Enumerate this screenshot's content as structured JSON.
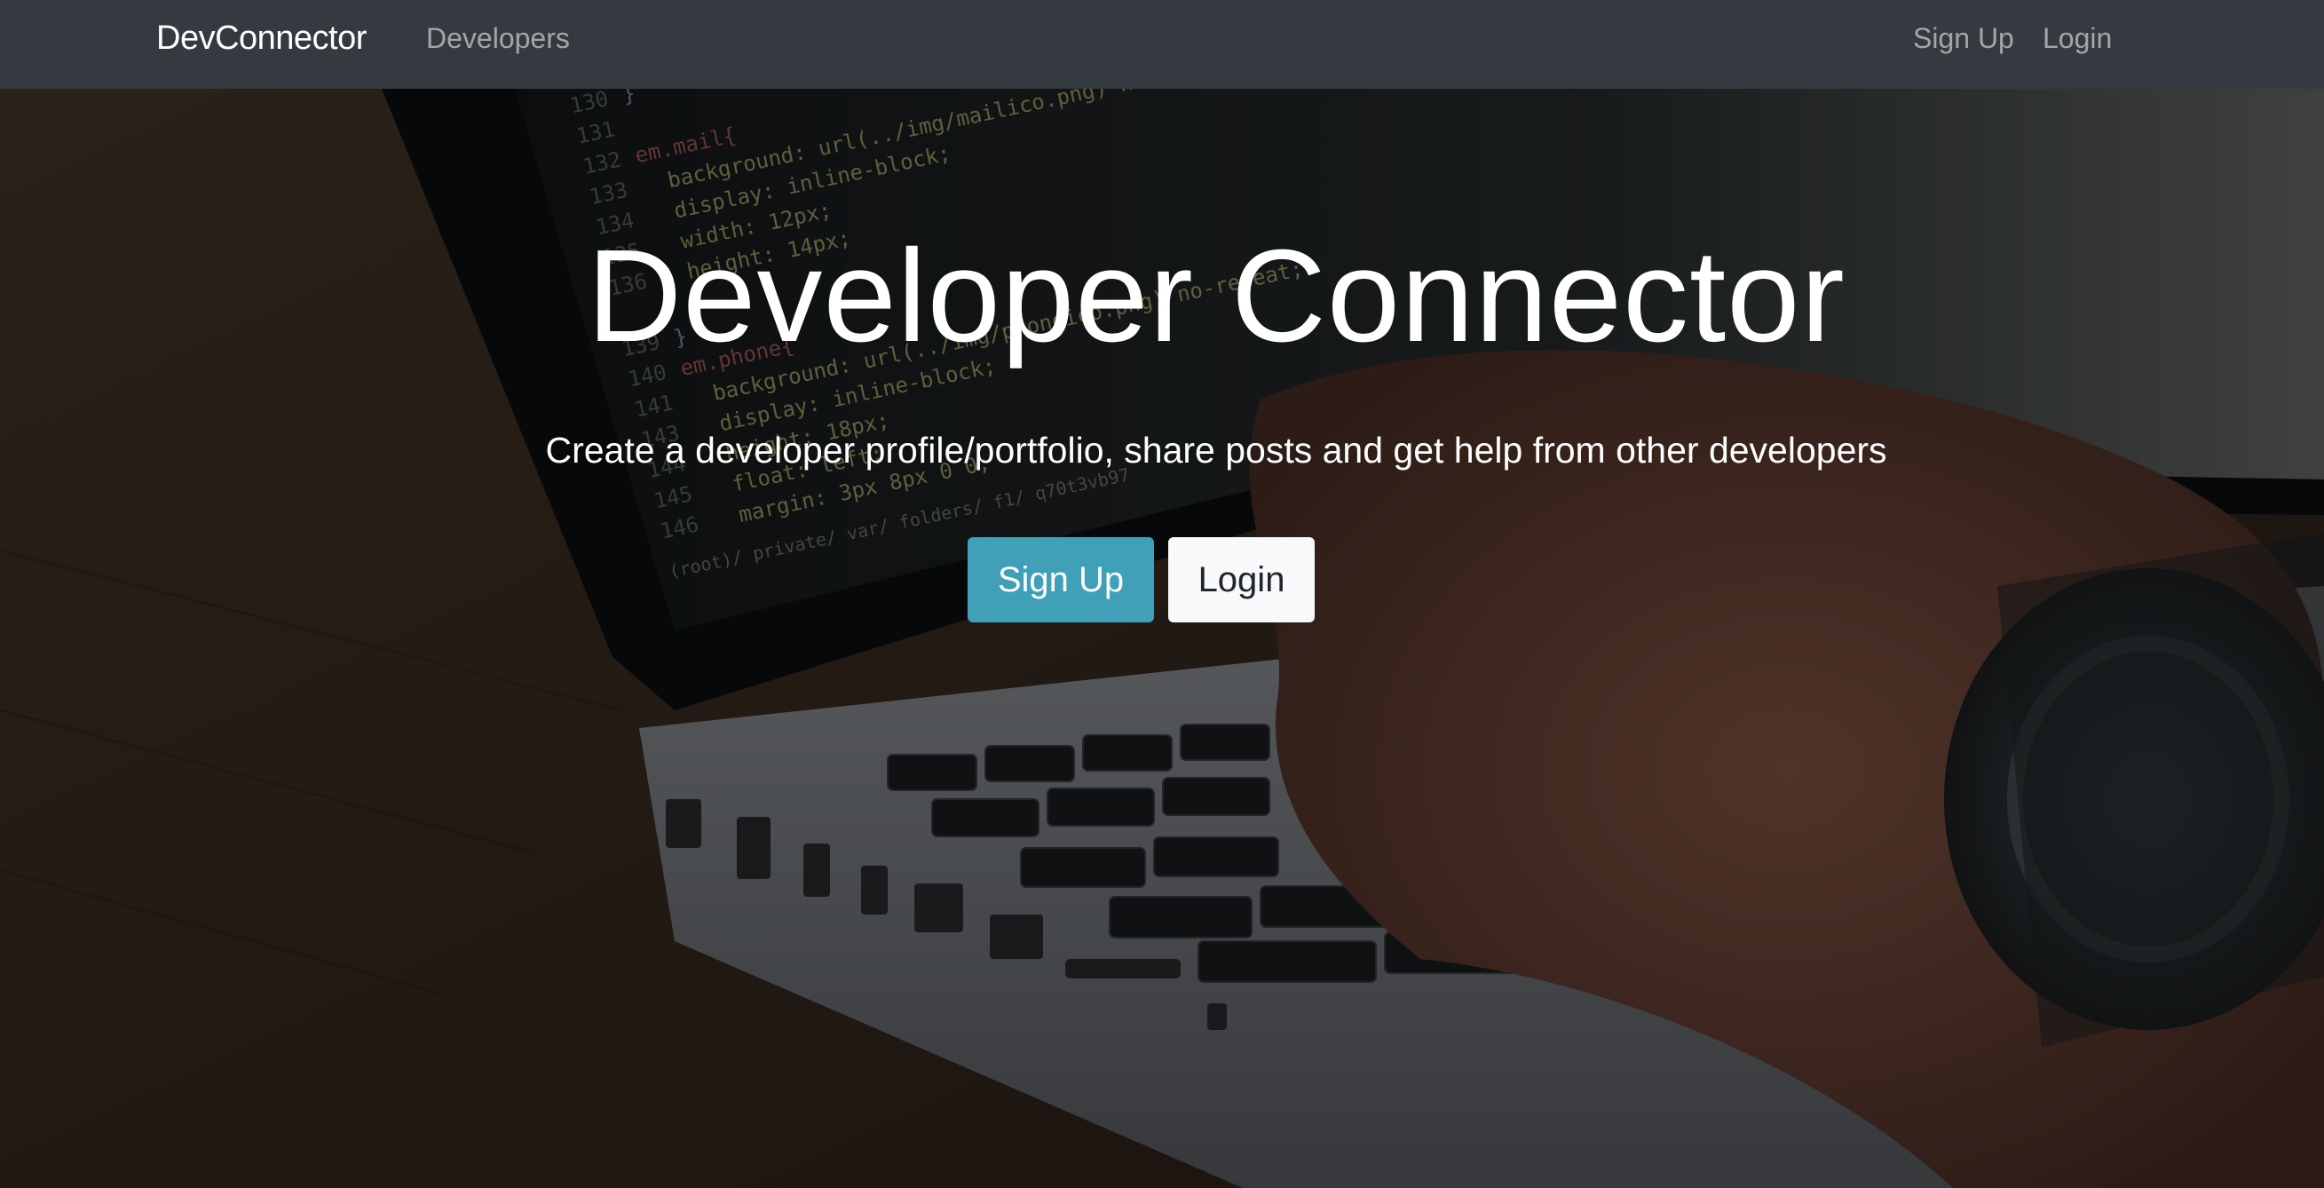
{
  "navbar": {
    "brand": "DevConnector",
    "links": {
      "developers": "Developers",
      "sign_up": "Sign Up",
      "login": "Login"
    },
    "background": "#343a40"
  },
  "hero": {
    "title": "Developer Connector",
    "lead": "Create a developer profile/portfolio, share posts and get help from other developers",
    "buttons": {
      "sign_up": "Sign Up",
      "login": "Login"
    },
    "background_image": "laptop-keyboard-photo",
    "code_lines": [
      {
        "num": "130",
        "text": "}"
      },
      {
        "num": "131",
        "text": ""
      },
      {
        "num": "132",
        "text": "em.mail{"
      },
      {
        "num": "133",
        "text": "  background: url(../img/mailico.png) no-repeat center;"
      },
      {
        "num": "134",
        "text": "  display: inline-block;"
      },
      {
        "num": "135",
        "text": "  width: 12px;"
      },
      {
        "num": "136",
        "text": "  height: 14px;"
      },
      {
        "num": "139",
        "text": "}"
      },
      {
        "num": "140",
        "text": "em.phone{"
      },
      {
        "num": "141",
        "text": "  background: url(../img/phoneico.png) no-repeat;"
      },
      {
        "num": "143",
        "text": "  display: inline-block;"
      },
      {
        "num": "144",
        "text": "  height: 18px;"
      },
      {
        "num": "145",
        "text": "  float: left;"
      },
      {
        "num": "146",
        "text": "  margin: 3px 8px 0 0;"
      }
    ],
    "path_text": "(root)/ private/ var/ folders/ f1/ q70t3vb97"
  },
  "colors": {
    "primary_button": "#3fa0b8",
    "light_button": "#f8f9fa",
    "text_light": "#ffffff"
  }
}
